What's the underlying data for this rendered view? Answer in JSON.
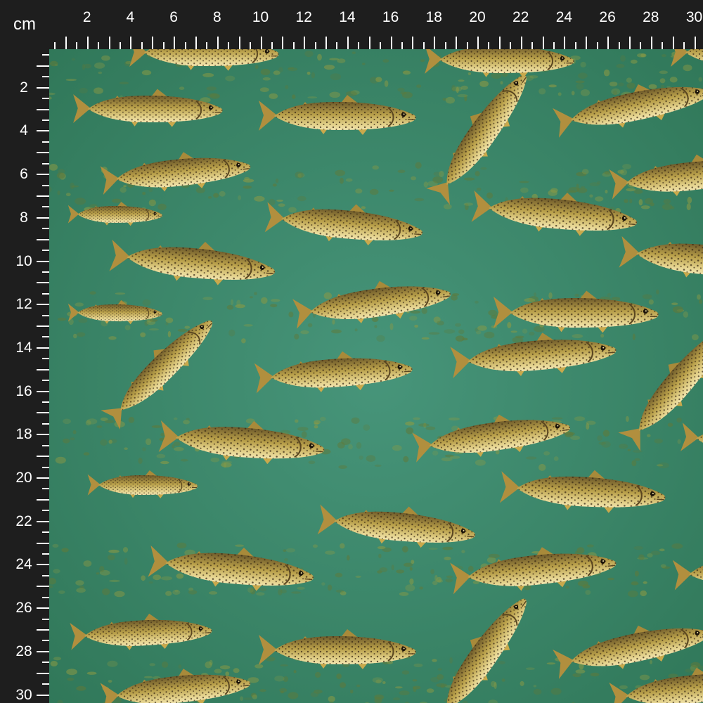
{
  "ruler": {
    "unit_label": "cm",
    "top_labels": [
      "2",
      "4",
      "6",
      "8",
      "10",
      "12",
      "14",
      "16",
      "18",
      "20",
      "22",
      "24",
      "26",
      "28",
      "30"
    ],
    "left_labels": [
      "2",
      "4",
      "6",
      "8",
      "10",
      "12",
      "14",
      "16",
      "18",
      "20",
      "22",
      "24",
      "26",
      "28",
      "30"
    ]
  },
  "fabric": {
    "pattern": "brown trout swimming in green water",
    "water_color": "#3f8a66",
    "gravel_color": "#7a8a3a",
    "fish_body_color": "#b9a04a",
    "fish_belly_color": "#efe0a0",
    "fish_fin_color": "#c9a94c",
    "spot_color": "#3a2a15",
    "ruler_bg": "#1e1e1e",
    "ruler_fg": "#ffffff"
  }
}
